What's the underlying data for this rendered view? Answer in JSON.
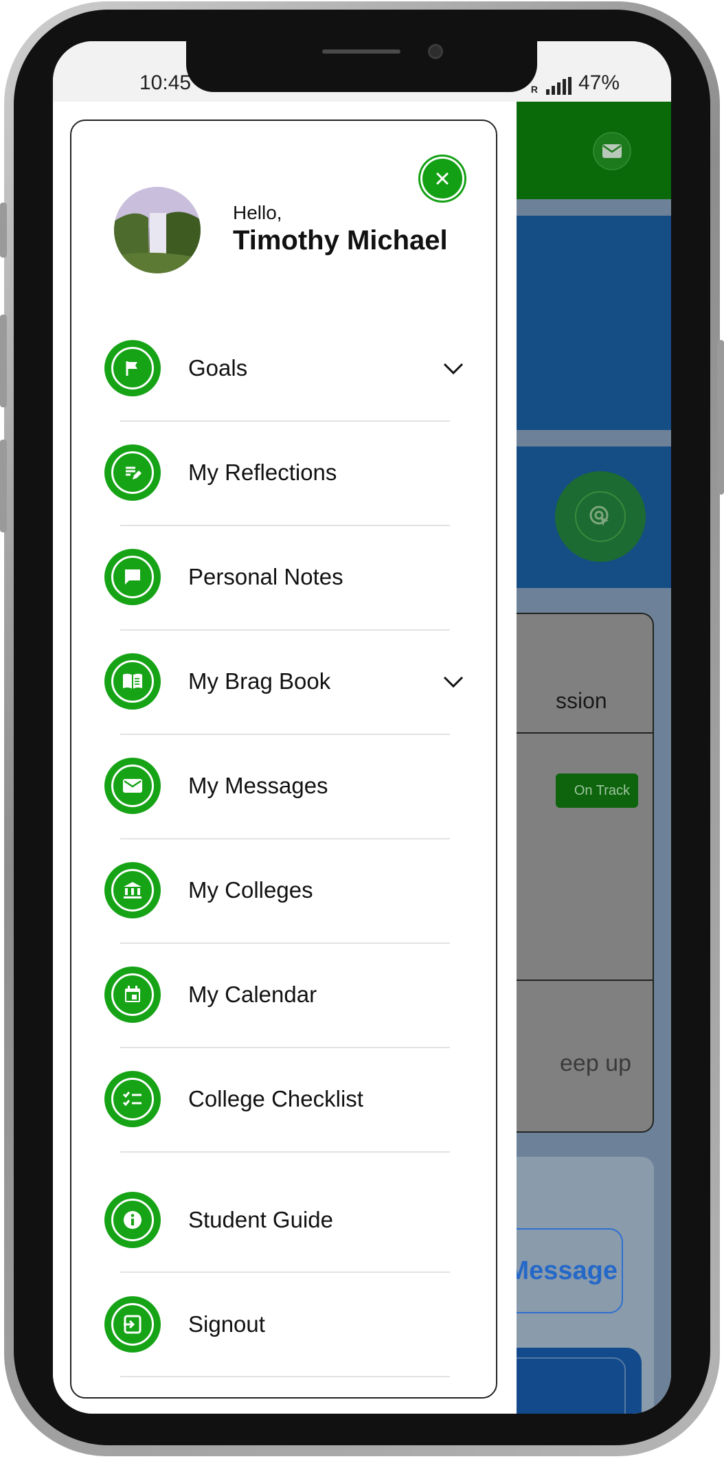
{
  "status_bar": {
    "time": "10:45",
    "battery": "47%",
    "network_indicator": "R"
  },
  "user": {
    "greeting": "Hello,",
    "name": "Timothy Michael"
  },
  "menu": {
    "items": [
      {
        "label": "Goals",
        "icon": "flag-icon",
        "expandable": true
      },
      {
        "label": "My Reflections",
        "icon": "edit-note-icon",
        "expandable": false
      },
      {
        "label": "Personal Notes",
        "icon": "chat-bubble-icon",
        "expandable": false
      },
      {
        "label": "My Brag Book",
        "icon": "open-book-icon",
        "expandable": true
      },
      {
        "label": "My Messages",
        "icon": "envelope-icon",
        "expandable": false
      },
      {
        "label": "My Colleges",
        "icon": "institution-icon",
        "expandable": false
      },
      {
        "label": "My Calendar",
        "icon": "calendar-icon",
        "expandable": false
      },
      {
        "label": "College Checklist",
        "icon": "checklist-icon",
        "expandable": false
      },
      {
        "label": "Student Guide",
        "icon": "info-icon",
        "expandable": false
      },
      {
        "label": "Signout",
        "icon": "signout-icon",
        "expandable": false
      }
    ]
  },
  "background": {
    "session_text": "ssion",
    "status_badge": "On Track",
    "keep_up_text": "eep up",
    "message_button": "Message"
  },
  "colors": {
    "accent_green": "#16a316",
    "header_green": "#0a6a0a",
    "band_blue": "#154d85",
    "link_blue": "#2468c8"
  }
}
